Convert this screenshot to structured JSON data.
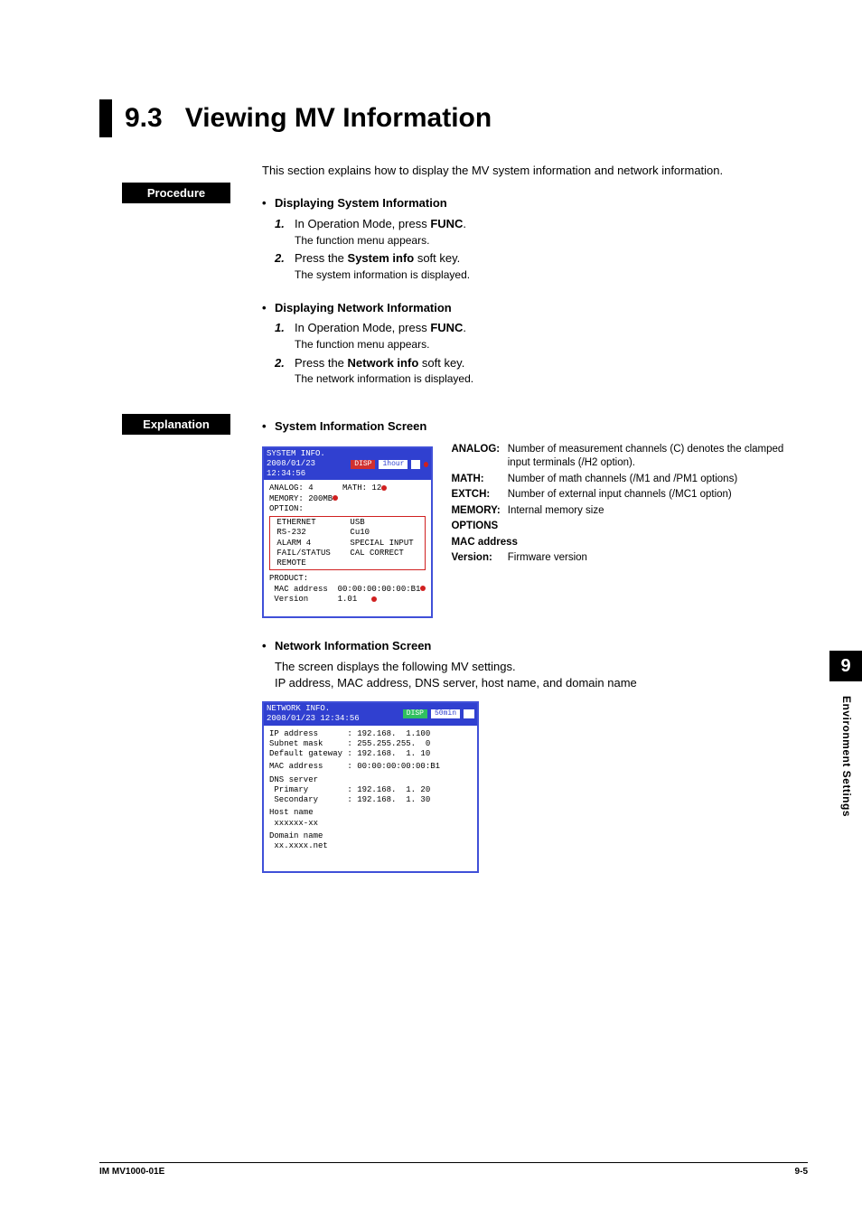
{
  "section_number": "9.3",
  "section_title": "Viewing MV Information",
  "intro": "This section explains how to display the MV system information and network information.",
  "labels": {
    "procedure": "Procedure",
    "explanation": "Explanation"
  },
  "proc": {
    "sys": {
      "heading": "Displaying System Information",
      "s1a": "In Operation Mode, press ",
      "s1b": "FUNC",
      "s1c": ".",
      "s1sub": "The function menu appears.",
      "s2a": "Press the ",
      "s2b": "System info",
      "s2c": " soft key.",
      "s2sub": "The system information is displayed."
    },
    "net": {
      "heading": "Displaying Network Information",
      "s1a": "In Operation Mode, press ",
      "s1b": "FUNC",
      "s1c": ".",
      "s1sub": "The function menu appears.",
      "s2a": "Press the ",
      "s2b": "Network info",
      "s2c": " soft key.",
      "s2sub": "The network information is displayed."
    }
  },
  "expl": {
    "sys_heading": "System Information Screen",
    "net_heading": "Network Information Screen",
    "net_line1": "The screen displays the following MV settings.",
    "net_line2": "IP address, MAC address, DNS server, host name, and domain name"
  },
  "sys_screen": {
    "hdr_title": "SYSTEM INFO.",
    "hdr_time": "2008/01/23 12:34:56",
    "hdr_chip1": "DISP",
    "hdr_chip2": "1hour",
    "r1": "ANALOG: 4      MATH: 12",
    "r2": "MEMORY: 200MB",
    "r3": "OPTION:",
    "opt1": " ETHERNET       USB",
    "opt2": " RS-232         Cu10",
    "opt3": " ALARM 4        SPECIAL INPUT",
    "opt4": " FAIL/STATUS    CAL CORRECT",
    "opt5": " REMOTE",
    "r4": "PRODUCT:",
    "r5": " MAC address  00:00:00:00:00:B1",
    "r6": " Version      1.01"
  },
  "net_screen": {
    "hdr_title": "NETWORK INFO.",
    "hdr_time": "2008/01/23 12:34:56",
    "hdr_chip1": "DISP",
    "hdr_chip2": "50min",
    "r1": "IP address      : 192.168.  1.100",
    "r2": "Subnet mask     : 255.255.255.  0",
    "r3": "Default gateway : 192.168.  1. 10",
    "r4": "MAC address     : 00:00:00:00:00:B1",
    "r5": "DNS server",
    "r6": " Primary        : 192.168.  1. 20",
    "r7": " Secondary      : 192.168.  1. 30",
    "r8": "Host name",
    "r9": " xxxxxx-xx",
    "r10": "Domain name",
    "r11": " xx.xxxx.net"
  },
  "annot": {
    "analog_k": "ANALOG:",
    "analog_v": "Number of measurement channels (C) denotes the clamped input terminals (/H2 option).",
    "math_k": "MATH:",
    "math_v": "Number of math channels (/M1 and /PM1 options)",
    "extch_k": "EXTCH:",
    "extch_v": "Number of external input channels (/MC1 option)",
    "memory_k": "MEMORY:",
    "memory_v": "Internal memory size",
    "options_k": "OPTIONS",
    "mac_k": "MAC address",
    "version_k": "Version:",
    "version_v": "Firmware version"
  },
  "sidebar": {
    "chapter": "9",
    "label": "Environment Settings"
  },
  "footer": {
    "left": "IM MV1000-01E",
    "right": "9-5"
  }
}
